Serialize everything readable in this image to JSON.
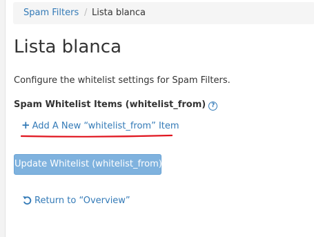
{
  "breadcrumb": {
    "parent": "Spam Filters",
    "separator": "/",
    "current": "Lista blanca"
  },
  "page": {
    "title": "Lista blanca",
    "description": "Configure the whitelist settings for Spam Filters."
  },
  "whitelist": {
    "section_label": "Spam Whitelist Items (whitelist_from)",
    "help_icon": "question-circle-icon",
    "help_glyph": "?",
    "add_icon": "plus-icon",
    "add_link": "Add A New “whitelist_from” Item",
    "update_button": "Update Whitelist (whitelist_from)",
    "return_icon": "undo-arrow-icon",
    "return_link": "Return to “Overview”"
  },
  "colors": {
    "link": "#337ab7",
    "button_disabled": "#7fb2de",
    "annotation_underline": "#e0141e"
  }
}
